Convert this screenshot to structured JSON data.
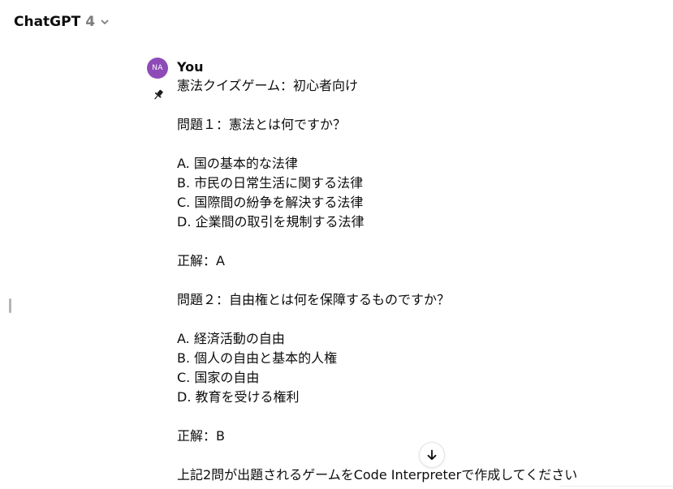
{
  "header": {
    "model_name": "ChatGPT",
    "model_version": "4"
  },
  "message": {
    "avatar_initials": "NA",
    "avatar_color": "#8e4bb8",
    "author": "You",
    "lines": [
      "憲法クイズゲーム：初心者向け",
      "",
      "問題１：憲法とは何ですか？",
      "",
      "A. 国の基本的な法律",
      "B. 市民の日常生活に関する法律",
      "C. 国際間の紛争を解決する法律",
      "D. 企業間の取引を規制する法律",
      "",
      "正解：A",
      "",
      "問題２：自由権とは何を保障するものですか？",
      "",
      "A. 経済活動の自由",
      "B. 個人の自由と基本的人権",
      "C. 国家の自由",
      "D. 教育を受ける権利",
      "",
      "正解：B",
      "",
      "上記2問が出題されるゲームをCode Interpreterで作成してください"
    ]
  },
  "icons": {
    "chevron": "chevron-down-icon",
    "pin": "pin-icon",
    "scroll": "arrow-down-icon"
  }
}
